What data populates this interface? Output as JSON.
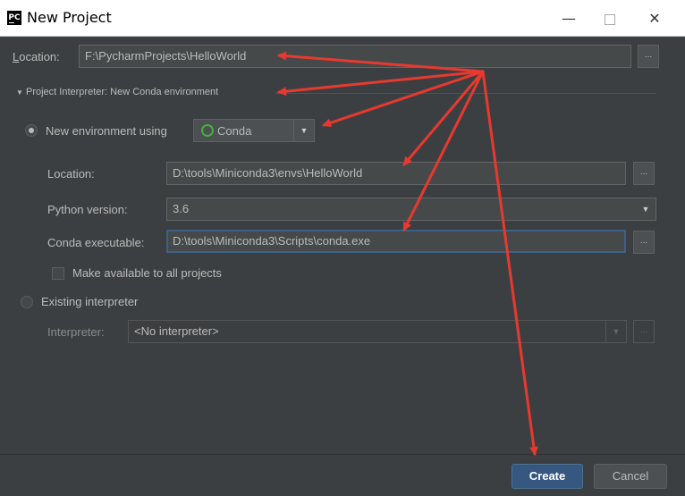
{
  "window": {
    "title": "New Project",
    "app_icon_text": "PC",
    "minimize_glyph": "—",
    "close_glyph": "✕"
  },
  "location": {
    "label": "Location:",
    "value": "F:\\PycharmProjects\\HelloWorld",
    "browse": "..."
  },
  "interpreter_section": {
    "toggle_glyph": "▼",
    "title": "Project Interpreter: New Conda environment"
  },
  "new_env": {
    "radio_label": "New environment using",
    "selected": true,
    "tool": "Conda",
    "tool_arrow": "▼",
    "location_label": "Location:",
    "location_value": "D:\\tools\\Miniconda3\\envs\\HelloWorld",
    "location_browse": "...",
    "python_label": "Python version:",
    "python_value": "3.6",
    "python_arrow": "▼",
    "conda_label": "Conda executable:",
    "conda_value": "D:\\tools\\Miniconda3\\Scripts\\conda.exe",
    "conda_browse": "...",
    "make_available_label": "Make available to all projects",
    "make_available_checked": false
  },
  "existing": {
    "radio_label": "Existing interpreter",
    "selected": false,
    "interpreter_label": "Interpreter:",
    "interpreter_value": "<No interpreter>",
    "interpreter_arrow": "▼",
    "browse": "..."
  },
  "buttons": {
    "create": "Create",
    "cancel": "Cancel"
  },
  "colors": {
    "background": "#3c3f41",
    "field": "#45494a",
    "primary_button": "#365880",
    "annotation_arrow": "#e8392f",
    "conda_icon": "#45b03a"
  }
}
